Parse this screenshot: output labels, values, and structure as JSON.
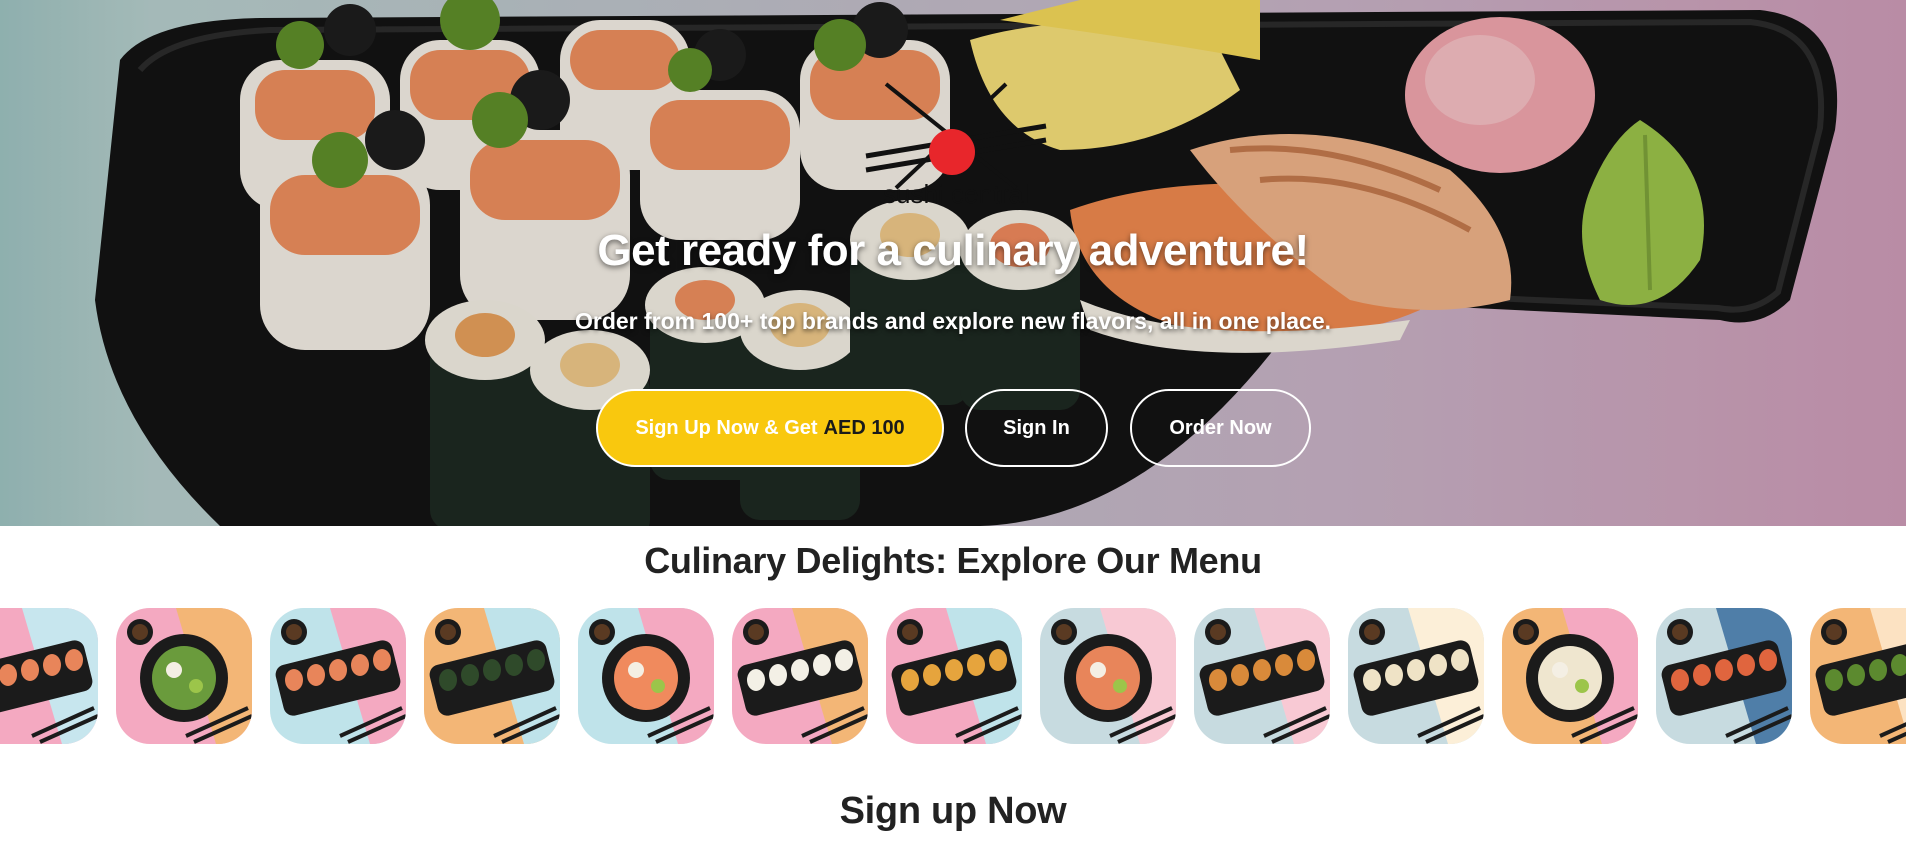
{
  "brand": {
    "logo_text": "sushi central"
  },
  "hero": {
    "title": "Get ready for a culinary adventure!",
    "subtitle": "Order from 100+ top brands and explore new flavors, all in one place.",
    "buttons": {
      "signup_prefix": "Sign Up Now & Get",
      "signup_amount": "AED 100",
      "signin": "Sign In",
      "order": "Order Now"
    }
  },
  "menu": {
    "title": "Culinary Delights: Explore Our Menu",
    "items": [
      {
        "name": "sushi-platter-icon",
        "bg": [
          "#f4a9c1",
          "#c7e6ee"
        ],
        "plate": "#1b1b1b",
        "food": "#e8855a"
      },
      {
        "name": "salad-bowl-icon",
        "bg": [
          "#f4a9c1",
          "#f3b676"
        ],
        "plate": "#1b1b1b",
        "food": "#6a9b3c"
      },
      {
        "name": "salmon-roll-platter-icon",
        "bg": [
          "#bfe3ea",
          "#f4a9c1"
        ],
        "plate": "#1b1b1b",
        "food": "#e8855a"
      },
      {
        "name": "seaweed-roll-platter-icon",
        "bg": [
          "#f3b676",
          "#bfe3ea"
        ],
        "plate": "#1b1b1b",
        "food": "#2f4a2a"
      },
      {
        "name": "nigiri-plate-icon",
        "bg": [
          "#bfe3ea",
          "#f4a9c1"
        ],
        "plate": "#1b1b1b",
        "food": "#f08a5d"
      },
      {
        "name": "rice-side-tray-icon",
        "bg": [
          "#f4a9c1",
          "#f3b676"
        ],
        "plate": "#1b1b1b",
        "food": "#f3f0e6"
      },
      {
        "name": "fried-bites-tray-icon",
        "bg": [
          "#f4a9c1",
          "#bfe3ea"
        ],
        "plate": "#1b1b1b",
        "food": "#e6a43d"
      },
      {
        "name": "poke-bowl-icon",
        "bg": [
          "#c7dbe0",
          "#f8c9d4"
        ],
        "plate": "#1b1b1b",
        "food": "#e8855a"
      },
      {
        "name": "chicken-bowl-icon",
        "bg": [
          "#c7dbe0",
          "#f8c9d4"
        ],
        "plate": "#1b1b1b",
        "food": "#d98a3a"
      },
      {
        "name": "wrap-plate-icon",
        "bg": [
          "#c7dbe0",
          "#fcefd8"
        ],
        "plate": "#1b1b1b",
        "food": "#efe3c6"
      },
      {
        "name": "gyoza-tray-icon",
        "bg": [
          "#f3b676",
          "#f4a9c1"
        ],
        "plate": "#1b1b1b",
        "food": "#efe6cf"
      },
      {
        "name": "tuna-bowl-icon",
        "bg": [
          "#c7dbe0",
          "#4f7ea8"
        ],
        "plate": "#1b1b1b",
        "food": "#e0653e"
      },
      {
        "name": "noodle-bowl-icon",
        "bg": [
          "#f3b676",
          "#fce2c2"
        ],
        "plate": "#1b1b1b",
        "food": "#5c8a2f"
      }
    ]
  },
  "signup": {
    "title": "Sign up Now"
  }
}
